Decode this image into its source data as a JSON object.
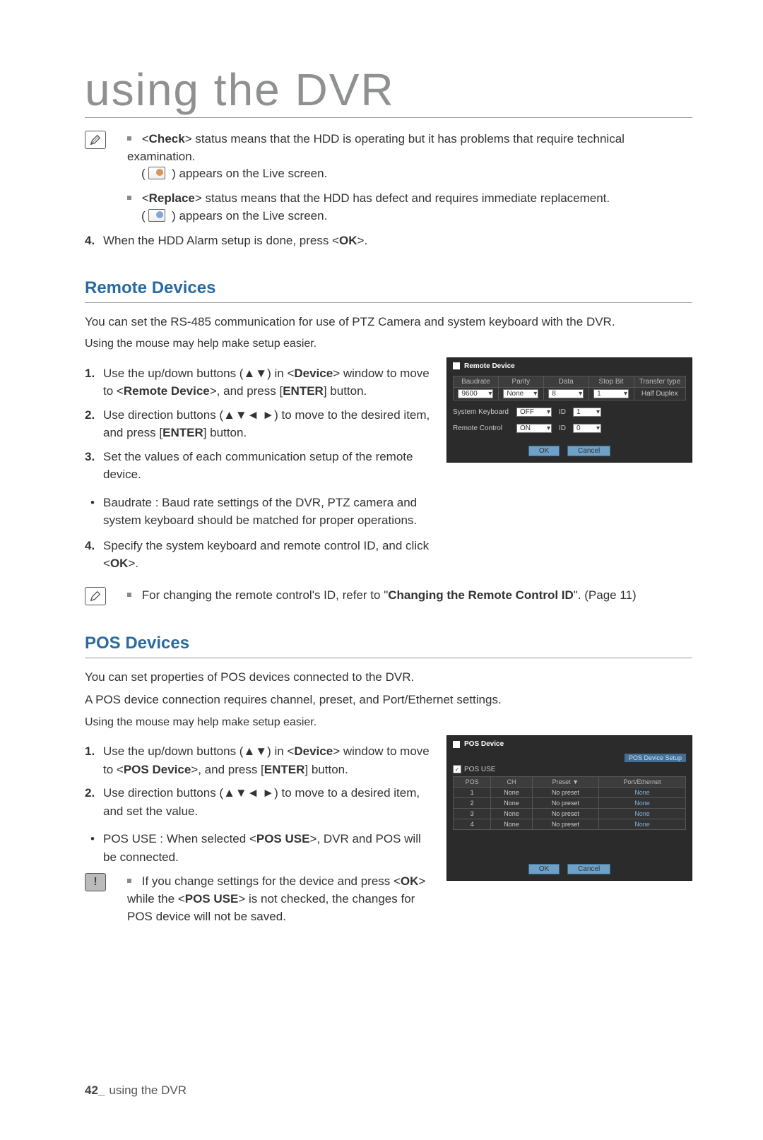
{
  "chapter_title": "using the DVR",
  "top_notes": {
    "check": {
      "bold": "Check",
      "text_before": "<",
      "text_after": "> status means that the HDD is operating but it has problems that require technical examination.",
      "sub": "appears on the Live screen."
    },
    "replace": {
      "bold": "Replace",
      "text_after": "> status means that the HDD has defect and requires immediate replacement.",
      "sub": "appears on the Live screen."
    }
  },
  "step4_top": {
    "pre": "When the HDD Alarm setup is done, press <",
    "bold": "OK",
    "post": ">."
  },
  "remote": {
    "heading": "Remote Devices",
    "intro": "You can set the RS-485 communication for use of PTZ Camera and system keyboard with the DVR.",
    "hint": "Using the mouse may help make setup easier.",
    "steps": [
      "Use the up/down buttons (▲▼) in <Device> window to move to <Remote Device>, and press [ENTER] button.",
      "Use direction buttons (▲▼◄ ►) to move to the desired item, and press [ENTER] button.",
      "Set the values of each communication setup of the remote device."
    ],
    "baudrate_bullet": "Baudrate : Baud rate settings of the DVR, PTZ camera and system keyboard should be matched for proper operations.",
    "step4": {
      "pre": "Specify the system keyboard and remote control ID, and click <",
      "bold": "OK",
      "post": ">."
    },
    "note": {
      "pre": "For changing the remote control's ID, refer to \"",
      "bold": "Changing the Remote Control ID",
      "post": "\". (Page 11)"
    },
    "panel": {
      "title": "Remote Device",
      "headers": [
        "Baudrate",
        "Parity",
        "Data",
        "Stop Bit",
        "Transfer type"
      ],
      "values": [
        "9600",
        "None",
        "8",
        "1",
        "Half Duplex"
      ],
      "sys_kb_label": "System Keyboard",
      "sys_kb_val": "OFF",
      "id_label": "ID",
      "sys_kb_id": "1",
      "rc_label": "Remote Control",
      "rc_val": "ON",
      "rc_id": "0",
      "ok": "OK",
      "cancel": "Cancel"
    }
  },
  "pos": {
    "heading": "POS Devices",
    "intro1": "You can set properties of POS devices connected to the DVR.",
    "intro2": "A POS device connection requires channel, preset, and Port/Ethernet settings.",
    "hint": "Using the mouse may help make setup easier.",
    "steps": [
      "Use the up/down buttons (▲▼) in <Device> window to move to <POS Device>, and press [ENTER] button.",
      "Use direction buttons (▲▼◄ ►) to move to a desired item, and set the value."
    ],
    "use_bullet": "POS USE : When selected <POS USE>, DVR and POS will be connected.",
    "caution": "If you change settings for the device and press <OK> while the <POS USE> is not checked, the changes for POS device will not be saved.",
    "panel": {
      "title": "POS Device",
      "pos_use_label": "POS USE",
      "setup_btn": "POS Device Setup",
      "headers": [
        "POS",
        "CH",
        "Preset ▼",
        "Port/Ethernet"
      ],
      "rows": [
        {
          "pos": "1",
          "ch": "None",
          "preset": "No preset",
          "pe": "None"
        },
        {
          "pos": "2",
          "ch": "None",
          "preset": "No preset",
          "pe": "None"
        },
        {
          "pos": "3",
          "ch": "None",
          "preset": "No preset",
          "pe": "None"
        },
        {
          "pos": "4",
          "ch": "None",
          "preset": "No preset",
          "pe": "None"
        }
      ],
      "ok": "OK",
      "cancel": "Cancel"
    }
  },
  "footer": {
    "page_num": "42_",
    "label": "using the DVR"
  }
}
